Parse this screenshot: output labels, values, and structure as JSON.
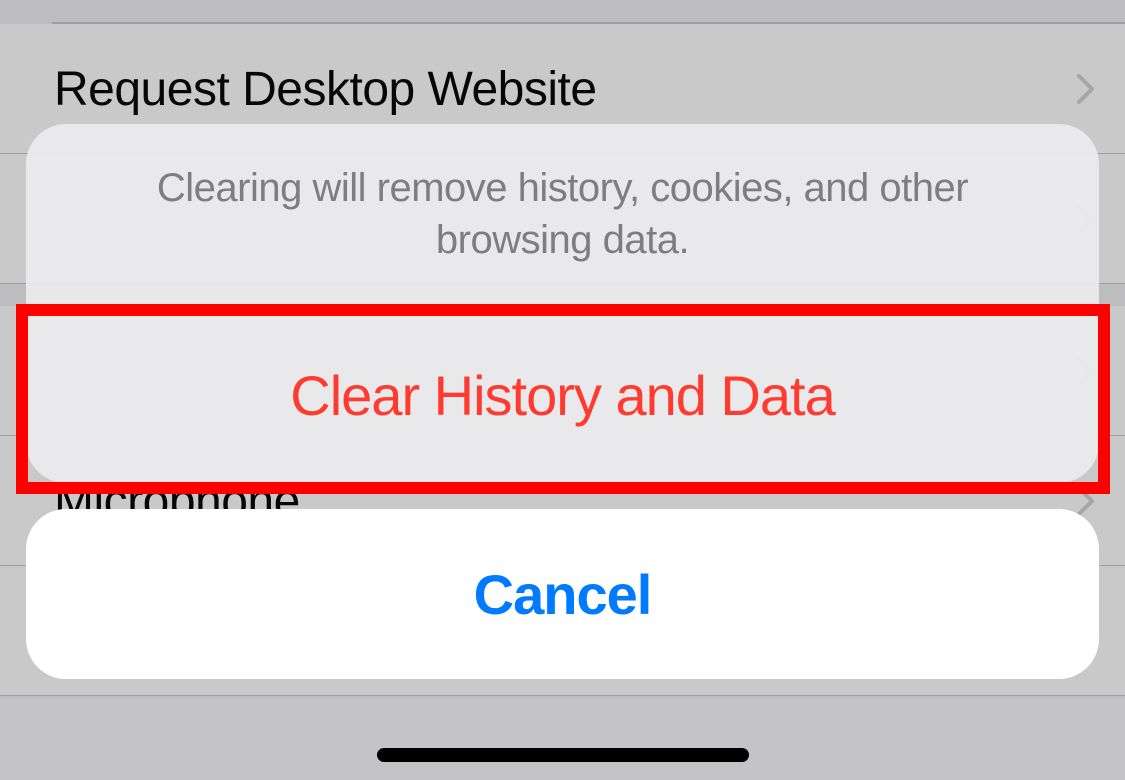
{
  "background": {
    "rows": {
      "requestDesktop": "Request Desktop Website",
      "microphone": "Microphone"
    }
  },
  "actionSheet": {
    "message": "Clearing will remove history, cookies, and other browsing data.",
    "destructiveAction": "Clear History and Data",
    "cancel": "Cancel"
  }
}
